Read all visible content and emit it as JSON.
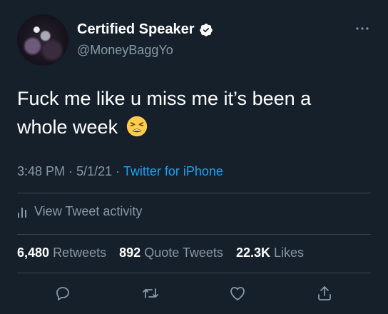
{
  "tweet": {
    "display_name": "Certified Speaker",
    "handle": "@MoneyBaggYo",
    "more_icon": "more-options-icon",
    "text_line1": "Fuck me like u miss me it’s been a",
    "text_line2": "whole week",
    "emoji": "tired-face-emoji",
    "time": "3:48 PM",
    "date": "5/1/21",
    "separator": "·",
    "source": "Twitter for iPhone",
    "activity_label": "View Tweet activity",
    "stats": {
      "retweets_count": "6,480",
      "retweets_label": "Retweets",
      "quotes_count": "892",
      "quotes_label": "Quote Tweets",
      "likes_count": "22.3K",
      "likes_label": "Likes"
    },
    "actions": [
      "reply-icon",
      "retweet-icon",
      "like-icon",
      "share-icon"
    ]
  },
  "colors": {
    "background": "#15202b",
    "text": "#ffffff",
    "secondary": "#8899a6",
    "link": "#1da1f2",
    "divider": "#38444d"
  }
}
